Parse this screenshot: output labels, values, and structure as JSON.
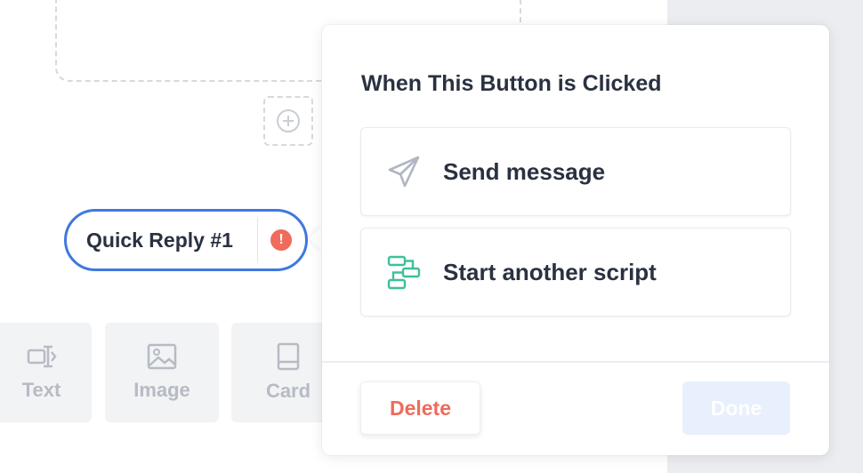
{
  "canvas": {
    "quick_reply": {
      "label": "Quick Reply #1",
      "warning_glyph": "!"
    },
    "add_block_icon": "plus-circle-icon",
    "tools": [
      {
        "label": "Text",
        "icon": "text-cursor-icon"
      },
      {
        "label": "Image",
        "icon": "image-icon"
      },
      {
        "label": "Card",
        "icon": "card-icon"
      }
    ]
  },
  "popover": {
    "title": "When This Button is Clicked",
    "options": [
      {
        "label": "Send message",
        "icon": "paper-plane-icon"
      },
      {
        "label": "Start another script",
        "icon": "flow-script-icon"
      }
    ],
    "delete_label": "Delete",
    "done_label": "Done"
  },
  "colors": {
    "accent_blue": "#3f78e0",
    "warning_red": "#ef6b5b",
    "script_green": "#3fbf9a",
    "done_disabled": "#e8f0fd"
  }
}
